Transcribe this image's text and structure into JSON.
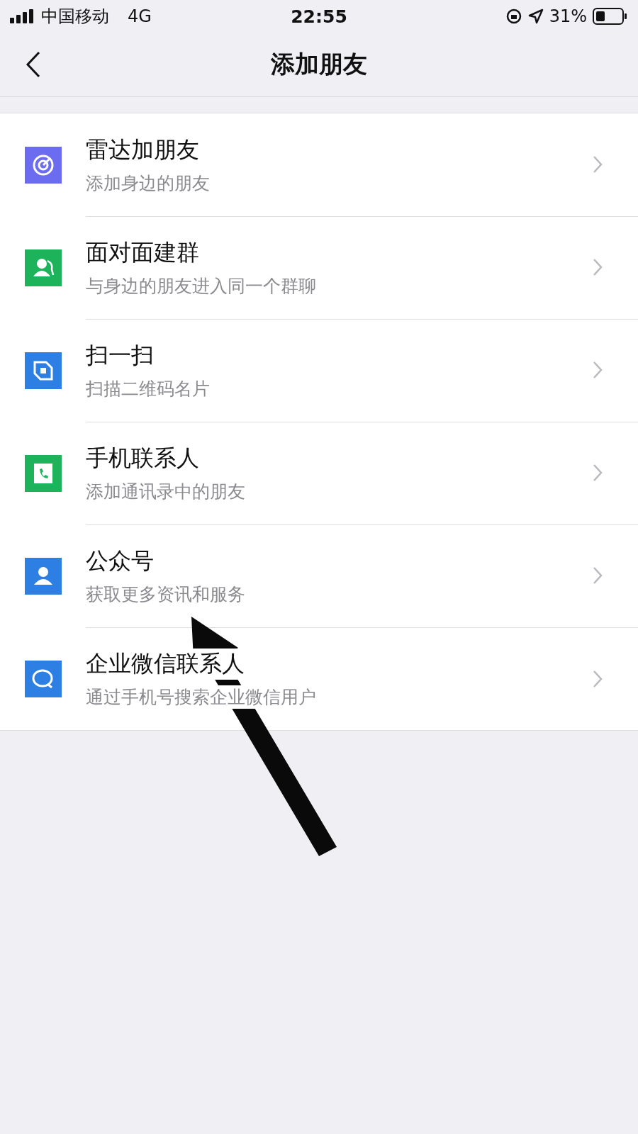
{
  "status_bar": {
    "carrier": "中国移动",
    "network": "4G",
    "time": "22:55",
    "battery": "31%"
  },
  "nav": {
    "title": "添加朋友"
  },
  "items": [
    {
      "kind": "radar",
      "title": "雷达加朋友",
      "subtitle": "添加身边的朋友"
    },
    {
      "kind": "group",
      "title": "面对面建群",
      "subtitle": "与身边的朋友进入同一个群聊"
    },
    {
      "kind": "scan",
      "title": "扫一扫",
      "subtitle": "扫描二维码名片"
    },
    {
      "kind": "phone",
      "title": "手机联系人",
      "subtitle": "添加通讯录中的朋友"
    },
    {
      "kind": "account",
      "title": "公众号",
      "subtitle": "获取更多资讯和服务"
    },
    {
      "kind": "chat",
      "title": "企业微信联系人",
      "subtitle": "通过手机号搜索企业微信用户"
    }
  ]
}
